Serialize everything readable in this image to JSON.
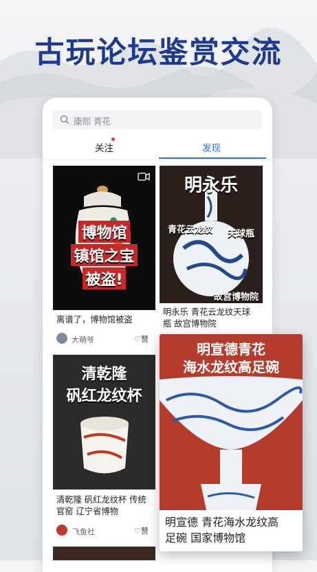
{
  "banner": {
    "title": "古玩论坛鉴赏交流"
  },
  "search": {
    "placeholder": "康熙 青花"
  },
  "tabs": [
    {
      "label": "关注"
    },
    {
      "label": "发现"
    }
  ],
  "posts": [
    {
      "overlay_lines": [
        "博物馆",
        "镇馆之宝",
        "被盗!"
      ],
      "caption": "离谱了，博物馆被盗",
      "author": "大萌爷",
      "like_label": "赞"
    },
    {
      "overlay_lines": [
        "明永乐",
        "青花云龙纹",
        "天球瓶",
        "故宫博物院"
      ],
      "caption_lines": [
        "明永乐 青花云龙纹天球",
        "瓶 故宫博物院"
      ]
    },
    {
      "overlay_lines": [
        "清乾隆",
        "矾红龙纹杯"
      ],
      "caption_lines": [
        "清乾隆 矾红龙纹杯 传统",
        "官窑 辽宁省博物"
      ],
      "author": "飞鱼社",
      "like_label": "赞"
    },
    {
      "overlay_lines": [
        "明宣德青花",
        "海水龙纹高足碗"
      ],
      "caption_lines": [
        "明宣德 青花海水龙纹高",
        "足碗 国家博物馆"
      ]
    }
  ],
  "colors": {
    "accent": "#2f6fd6",
    "title_blue": "#1e3a8f",
    "seal_red": "#c62828"
  }
}
